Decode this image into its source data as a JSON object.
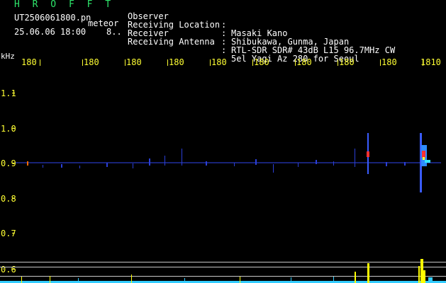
{
  "header": {
    "brand": "H R O F F T",
    "filename": "UT2506061800.pn",
    "tag": "meteor",
    "timestamp": "25.06.06 18:00    8..",
    "fields": [
      {
        "label": "Observer",
        "value": "Masaki Kano"
      },
      {
        "label": "Receiving Location",
        "value": "Shibukawa, Gunma, Japan"
      },
      {
        "label": "Receiver",
        "value": "RTL-SDR SDR# 43dB L15 96.7MHz CW"
      },
      {
        "label": "Receiving Antenna",
        "value": "5el Yagi Az 280 for Seoul"
      }
    ],
    "separator": ":"
  },
  "axes": {
    "unit": "kHz",
    "x_ticks": [
      "180",
      "180",
      "180",
      "180",
      "180",
      "180",
      "180",
      "180",
      "180",
      "1810"
    ],
    "y_ticks": [
      "1.1",
      "1.0",
      "0.9",
      "0.8",
      "0.7",
      "0.6"
    ]
  },
  "colors": {
    "text_green": "#2ee66b",
    "text_white": "#ffffff",
    "tick_yellow": "#ffff33",
    "background": "#000000",
    "signal_blue": "#3a5cff",
    "echo_red": "#ff3030",
    "level_yellow": "#ffff00",
    "baseline_cyan": "#33ccff"
  }
}
